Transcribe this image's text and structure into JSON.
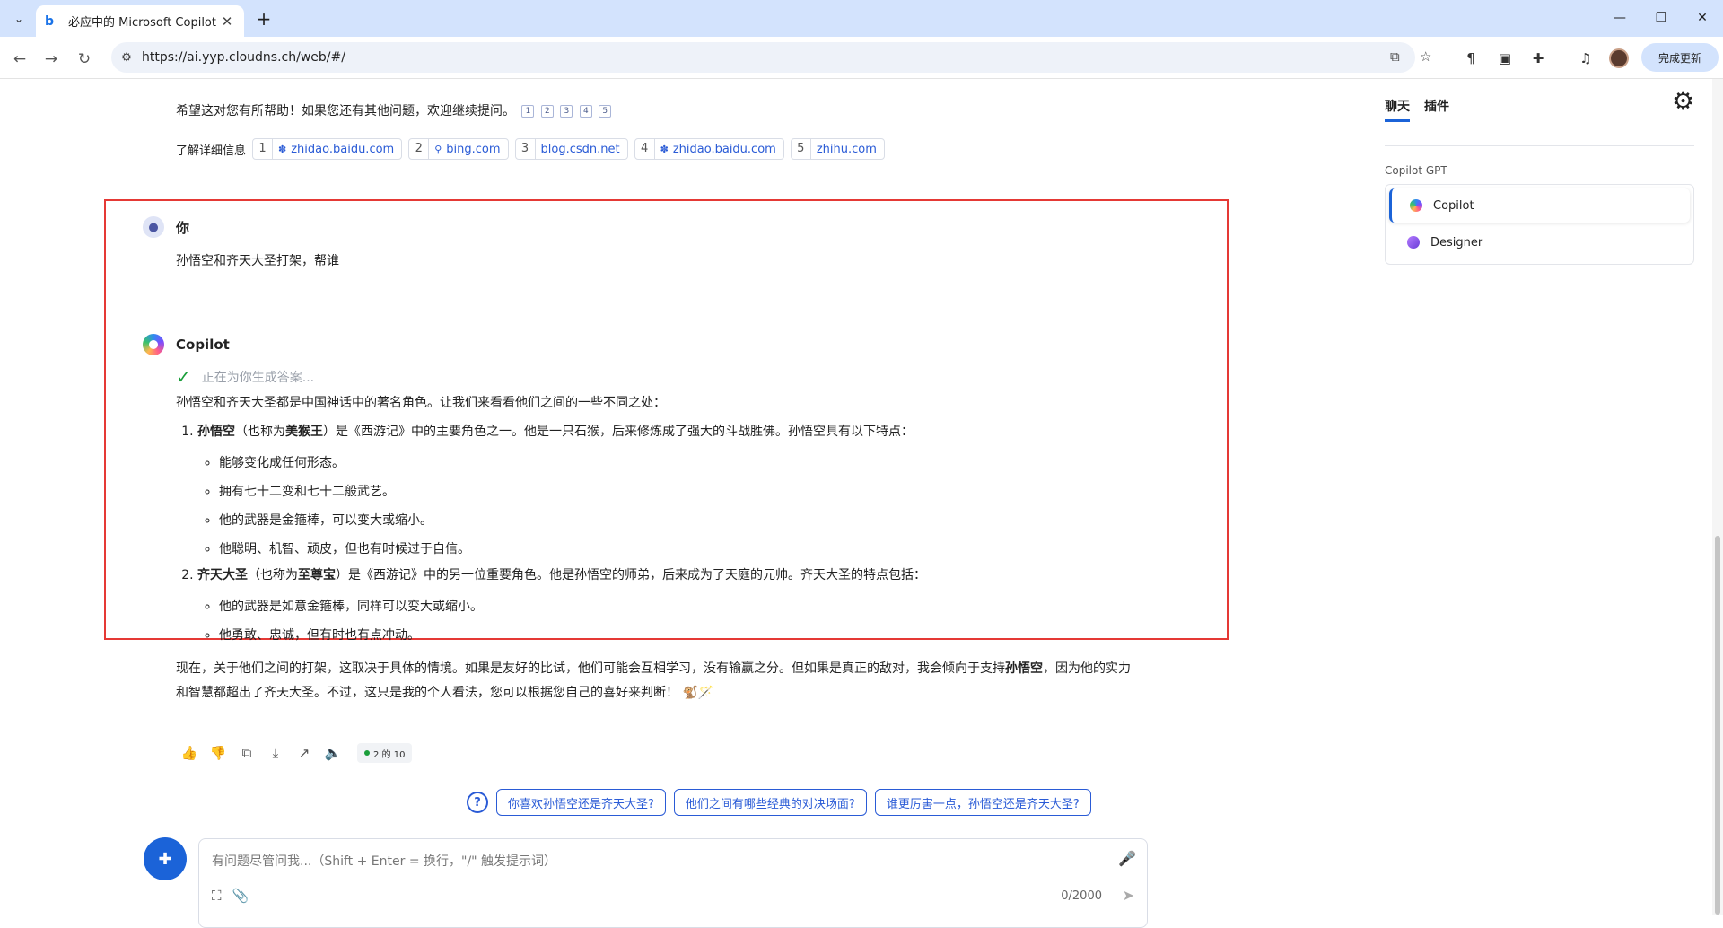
{
  "browser": {
    "tab_title": "必应中的 Microsoft Copilot",
    "url": "https://ai.yyp.cloudns.ch/web/#/",
    "update_button": "完成更新"
  },
  "previous_answer": {
    "closing": "希望这对您有所帮助！如果您还有其他问题，欢迎继续提问。",
    "refs": [
      "1",
      "2",
      "3",
      "4",
      "5"
    ],
    "learn_more_label": "了解详细信息",
    "citations": [
      {
        "n": "1",
        "site": "zhidao.baidu.com",
        "icon": "paw-icon"
      },
      {
        "n": "2",
        "site": "bing.com",
        "icon": "search-icon"
      },
      {
        "n": "3",
        "site": "blog.csdn.net",
        "icon": ""
      },
      {
        "n": "4",
        "site": "zhidao.baidu.com",
        "icon": "paw-icon"
      },
      {
        "n": "5",
        "site": "zhihu.com",
        "icon": ""
      }
    ]
  },
  "user_message": {
    "name": "你",
    "text": "孙悟空和齐天大圣打架，帮谁"
  },
  "copilot": {
    "name": "Copilot",
    "status": "正在为你生成答案...",
    "intro": "孙悟空和齐天大圣都是中国神话中的著名角色。让我们来看看他们之间的一些不同之处：",
    "items": [
      {
        "name": "孙悟空",
        "alias_pre": "（也称为",
        "alias": "美猴王",
        "desc": "）是《西游记》中的主要角色之一。他是一只石猴，后来修炼成了强大的斗战胜佛。孙悟空具有以下特点：",
        "traits": [
          "能够变化成任何形态。",
          "拥有七十二变和七十二般武艺。",
          "他的武器是金箍棒，可以变大或缩小。",
          "他聪明、机智、顽皮，但也有时候过于自信。"
        ]
      },
      {
        "name": "齐天大圣",
        "alias_pre": "（也称为",
        "alias": "至尊宝",
        "desc": "）是《西游记》中的另一位重要角色。他是孙悟空的师弟，后来成为了天庭的元帅。齐天大圣的特点包括：",
        "traits": [
          "他的武器是如意金箍棒，同样可以变大或缩小。",
          "他勇敢、忠诚，但有时也有点冲动。"
        ]
      }
    ],
    "closing_pre": "现在，关于他们之间的打架，这取决于具体的情境。如果是友好的比试，他们可能会互相学习，没有输赢之分。但如果是真正的敌对，我会倾向于支持",
    "closing_bold": "孙悟空",
    "closing_post": "，因为他的实力和智慧都超出了齐天大圣。不过，这只是我的个人看法，您可以根据您自己的喜好来判断！",
    "emojis": "🐒🪄",
    "turn_count": "2 的 10"
  },
  "suggestions": [
    "你喜欢孙悟空还是齐天大圣?",
    "他们之间有哪些经典的对决场面?",
    "谁更厉害一点，孙悟空还是齐天大圣?"
  ],
  "input": {
    "placeholder": "有问题尽管问我...（Shift + Enter = 换行，\"/\" 触发提示词）",
    "value": "",
    "char_count": "0/2000"
  },
  "sidebar": {
    "tabs": [
      "聊天",
      "插件"
    ],
    "section_label": "Copilot GPT",
    "gpts": [
      {
        "label": "Copilot",
        "selected": true,
        "icon": "copilot-icon"
      },
      {
        "label": "Designer",
        "selected": false,
        "icon": "designer-icon"
      }
    ]
  },
  "colors": {
    "accent": "#1b63d8",
    "highlight_border": "#e53935",
    "tabstrip": "#d3e3fd"
  }
}
